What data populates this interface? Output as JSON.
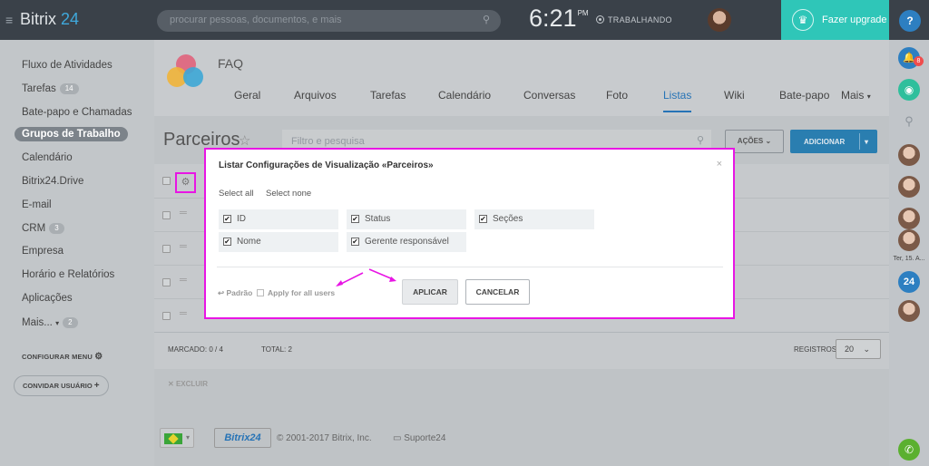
{
  "topbar": {
    "logo_name": "Bitrix",
    "logo_num": "24",
    "search_placeholder": "procurar pessoas, documentos, e mais",
    "time": "6:21",
    "ampm": "PM",
    "status": "TRABALHANDO",
    "upgrade_label": "Fazer upgrade",
    "help": "?"
  },
  "rail": {
    "notifications_count": "8",
    "date_label": "Ter, 15. A...",
    "b24": "24"
  },
  "leftmenu": {
    "items": [
      {
        "label": "Fluxo de Atividades",
        "count": ""
      },
      {
        "label": "Tarefas",
        "count": "14"
      },
      {
        "label": "Bate-papo e Chamadas",
        "count": ""
      },
      {
        "label": "Grupos de Trabalho",
        "count": ""
      },
      {
        "label": "Calendário",
        "count": ""
      },
      {
        "label": "Bitrix24.Drive",
        "count": ""
      },
      {
        "label": "E-mail",
        "count": ""
      },
      {
        "label": "CRM",
        "count": "3"
      },
      {
        "label": "Empresa",
        "count": ""
      },
      {
        "label": "Horário e Relatórios",
        "count": ""
      },
      {
        "label": "Aplicações",
        "count": ""
      },
      {
        "label": "Mais...",
        "count": "2"
      }
    ],
    "configure": "CONFIGURAR MENU",
    "invite": "CONVIDAR USUÁRIO"
  },
  "group": {
    "name": "FAQ",
    "tabs": [
      "Geral",
      "Arquivos",
      "Tarefas",
      "Calendário",
      "Conversas",
      "Foto",
      "Listas",
      "Wiki",
      "Bate-papo",
      "Mais"
    ],
    "active_tab": "Listas"
  },
  "list": {
    "title": "Parceiros",
    "filter_placeholder": "Filtro e pesquisa",
    "actions_label": "AÇÕES",
    "add_label": "ADICIONAR",
    "marked": "MARCADO: 0 / 4",
    "total": "TOTAL: 2",
    "records_label": "REGISTROS:",
    "records_value": "20",
    "delete_label": "EXCLUIR"
  },
  "footer": {
    "b24": "Bitrix24",
    "copyright": "© 2001-2017 Bitrix, Inc.",
    "support": "Suporte24"
  },
  "dialog": {
    "title": "Listar Configurações de Visualização «Parceiros»",
    "select_all": "Select all",
    "select_none": "Select none",
    "options": [
      "ID",
      "Status",
      "Seções",
      "Nome",
      "Gerente responsável"
    ],
    "default_label": "Padrão",
    "apply_all_label": "Apply for all users",
    "apply_button": "APLICAR",
    "cancel_button": "CANCELAR"
  },
  "colors": {
    "topbar": "#3a4149",
    "upgrade": "#2fc6b8",
    "accent": "#2673b6",
    "highlight": "#e815e4"
  }
}
